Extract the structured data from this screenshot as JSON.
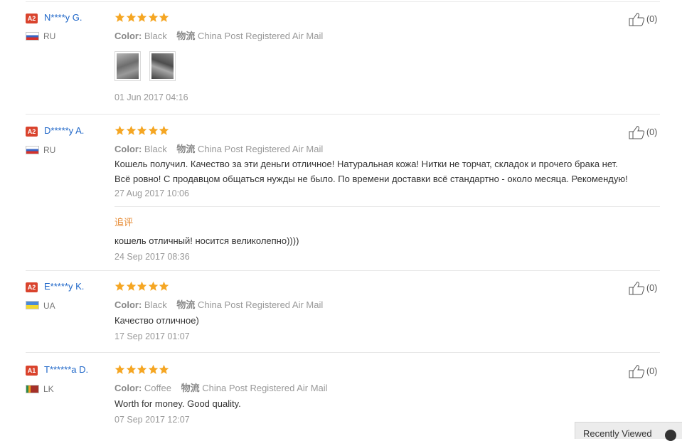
{
  "common": {
    "color_label": "Color:",
    "shipping_label": "物流",
    "shipping_value": "China Post Registered Air Mail"
  },
  "reviews": [
    {
      "badge": "A2",
      "name": "N****y G.",
      "country": "RU",
      "flag": "ru-flag-icon",
      "rating": 5,
      "color": "Black",
      "likes": "(0)",
      "text": "",
      "photos": 2,
      "date": "01 Jun 2017 04:16"
    },
    {
      "badge": "A2",
      "name": "D*****y A.",
      "country": "RU",
      "flag": "ru-flag-icon",
      "rating": 5,
      "color": "Black",
      "likes": "(0)",
      "text_line1": "Кошель получил. Качество за эти деньги отличное! Натуральная кожа! Нитки не торчат, складок и прочего брака нет.",
      "text_line2": "Всё ровно! С продавцом общаться нужды не было. По времени доставки всё стандартно - около месяца. Рекомендую!",
      "date": "27 Aug 2017 10:06",
      "followup": {
        "label": "追评",
        "text": "кошель отличный! носится великолепно))))",
        "date": "24 Sep 2017 08:36"
      }
    },
    {
      "badge": "A2",
      "name": "E*****y K.",
      "country": "UA",
      "flag": "ua-flag-icon",
      "rating": 5,
      "color": "Black",
      "likes": "(0)",
      "text": "Качество отличное)",
      "date": "17 Sep 2017 01:07"
    },
    {
      "badge": "A1",
      "name": "T******a D.",
      "country": "LK",
      "flag": "lk-flag-icon",
      "rating": 5,
      "color": "Coffee",
      "likes": "(0)",
      "text": "Worth for money. Good quality.",
      "date": "07 Sep 2017 12:07"
    }
  ],
  "recently_viewed": {
    "label": "Recently Viewed",
    "icon": "chevron-up-icon"
  },
  "colors": {
    "accent_star": "#f5a623",
    "name_link": "#1e66c8",
    "badge": "#d9432d",
    "followup": "#e6872e"
  }
}
